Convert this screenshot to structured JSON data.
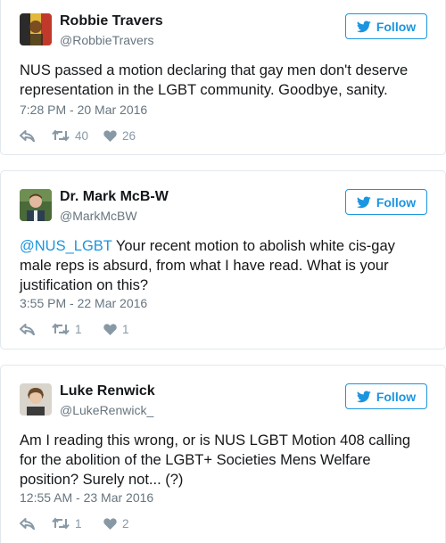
{
  "tweets": [
    {
      "name": "Robbie Travers",
      "handle": "@RobbieTravers",
      "follow_label": "Follow",
      "text": "NUS passed a motion declaring that gay men don't deserve representation in the LGBT community. Goodbye, sanity.",
      "timestamp": "7:28 PM - 20 Mar 2016",
      "retweets": "40",
      "likes": "26"
    },
    {
      "name": "Dr. Mark McB-W",
      "handle": "@MarkMcBW",
      "follow_label": "Follow",
      "mention": "@NUS_LGBT",
      "text": " Your recent motion to abolish white cis-gay male reps is absurd, from what I have read. What is your justification on this?",
      "timestamp": "3:55 PM - 22 Mar 2016",
      "retweets": "1",
      "likes": "1"
    },
    {
      "name": "Luke Renwick",
      "handle": "@LukeRenwick_",
      "follow_label": "Follow",
      "text": "Am I reading this wrong, or is NUS LGBT Motion 408 calling for the abolition of the LGBT+ Societies Mens Welfare position? Surely not... (?)",
      "timestamp": "12:55 AM - 23 Mar 2016",
      "retweets": "1",
      "likes": "2"
    }
  ],
  "colors": {
    "accent": "#1b95e0",
    "text": "#14171a",
    "muted": "#66757f",
    "icon": "#8899a6",
    "border": "#e1e8ed"
  },
  "icons": {
    "follow": "twitter-bird-icon",
    "reply": "reply-icon",
    "retweet": "retweet-icon",
    "like": "heart-icon"
  }
}
